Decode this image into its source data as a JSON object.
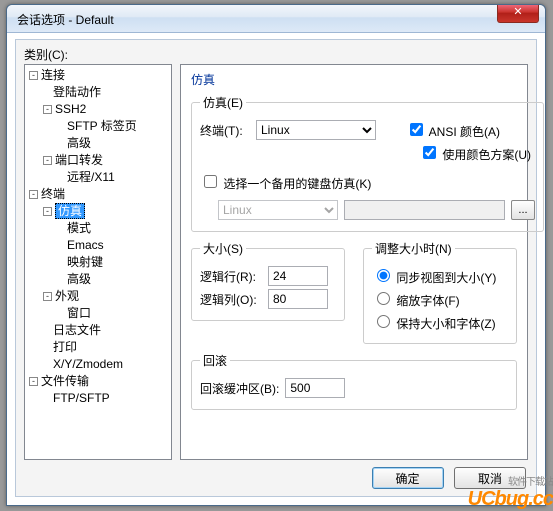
{
  "window": {
    "title": "会话选项 - Default"
  },
  "categories_label": "类别(C):",
  "tree": [
    {
      "pad": 4,
      "t": "连接",
      "tog": "-"
    },
    {
      "pad": 28,
      "t": "登陆动作"
    },
    {
      "pad": 18,
      "t": "SSH2",
      "tog": "-"
    },
    {
      "pad": 42,
      "t": "SFTP 标签页"
    },
    {
      "pad": 42,
      "t": "高级"
    },
    {
      "pad": 18,
      "t": "端口转发",
      "tog": "-"
    },
    {
      "pad": 42,
      "t": "远程/X11"
    },
    {
      "pad": 4,
      "t": "终端",
      "tog": "-"
    },
    {
      "pad": 18,
      "t": "仿真",
      "tog": "-",
      "sel": true
    },
    {
      "pad": 42,
      "t": "模式"
    },
    {
      "pad": 42,
      "t": "Emacs"
    },
    {
      "pad": 42,
      "t": "映射键"
    },
    {
      "pad": 42,
      "t": "高级"
    },
    {
      "pad": 18,
      "t": "外观",
      "tog": "-"
    },
    {
      "pad": 42,
      "t": "窗口"
    },
    {
      "pad": 28,
      "t": "日志文件"
    },
    {
      "pad": 28,
      "t": "打印"
    },
    {
      "pad": 28,
      "t": "X/Y/Zmodem"
    },
    {
      "pad": 4,
      "t": "文件传输",
      "tog": "-"
    },
    {
      "pad": 28,
      "t": "FTP/SFTP"
    }
  ],
  "panel": {
    "title": "仿真",
    "emulation": {
      "legend": "仿真(E)",
      "terminal_label": "终端(T):",
      "terminal_value": "Linux",
      "ansi_color": "ANSI 颜色(A)",
      "ansi_checked": true,
      "use_scheme": "使用颜色方案(U)",
      "use_scheme_checked": true,
      "alt_keyboard": "选择一个备用的键盘仿真(K)",
      "alt_value": "Linux",
      "browse": "..."
    },
    "size": {
      "legend": "大小(S)",
      "rows_label": "逻辑行(R):",
      "rows": "24",
      "cols_label": "逻辑列(O):",
      "cols": "80"
    },
    "resize": {
      "legend": "调整大小时(N)",
      "opt1": "同步视图到大小(Y)",
      "opt2": "缩放字体(F)",
      "opt3": "保持大小和字体(Z)"
    },
    "scrollback": {
      "legend": "回滚",
      "label": "回滚缓冲区(B):",
      "value": "500"
    }
  },
  "buttons": {
    "ok": "确定",
    "cancel": "取消"
  },
  "watermark": {
    "brand": "UCbug.cc",
    "sub": "软件下载站"
  }
}
